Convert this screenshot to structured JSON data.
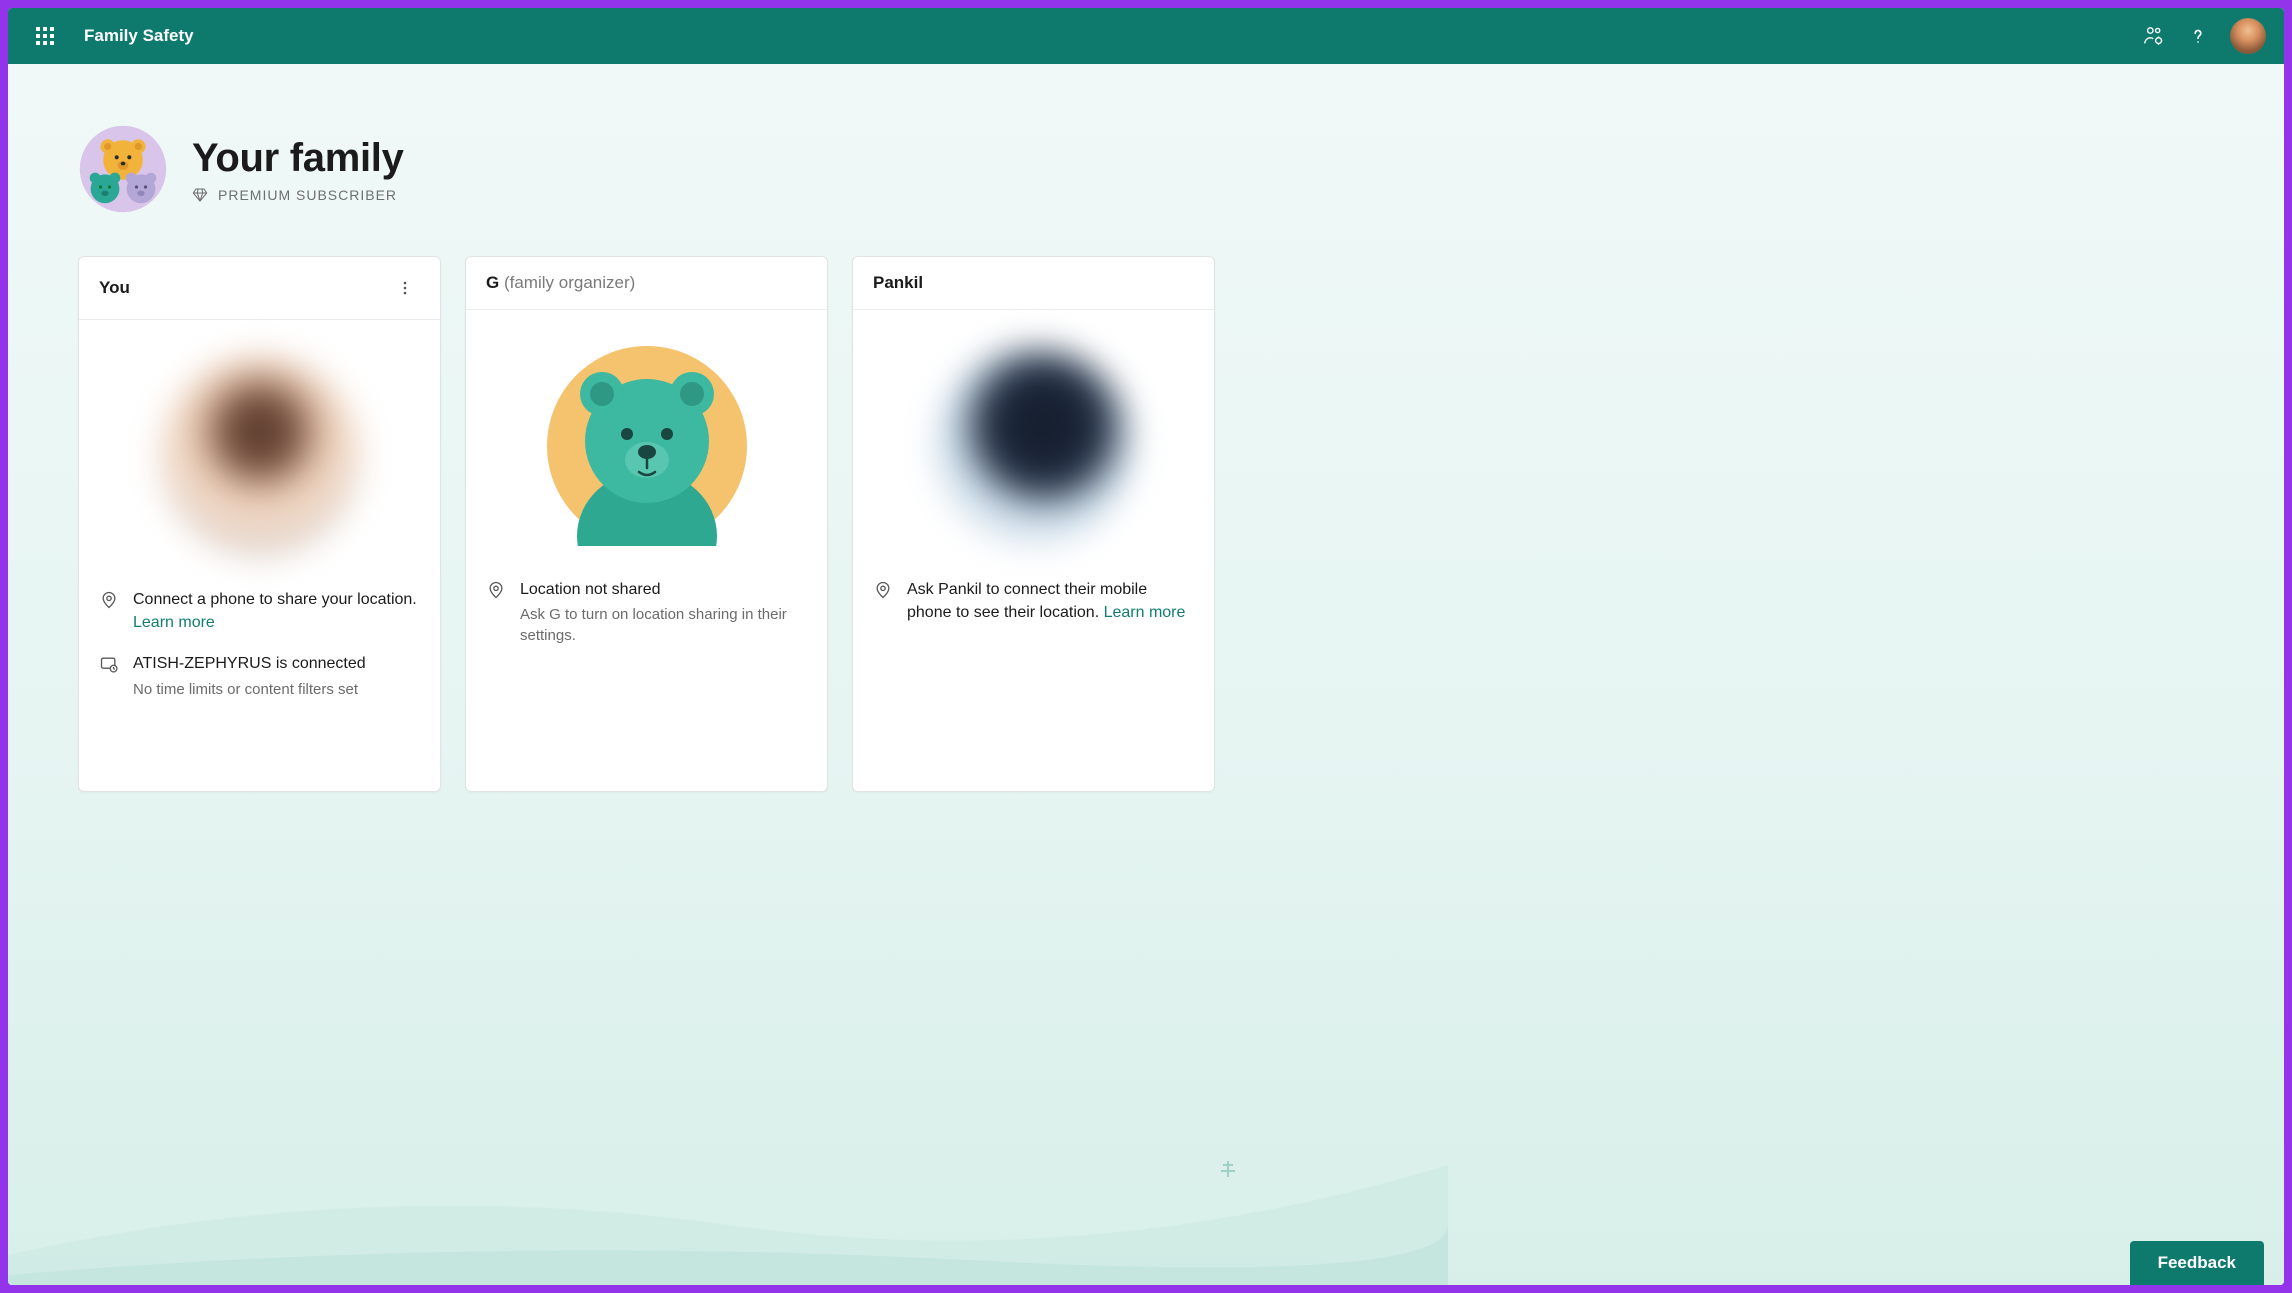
{
  "header": {
    "app_title": "Family Safety"
  },
  "page": {
    "title": "Your family",
    "premium_label": "PREMIUM SUBSCRIBER"
  },
  "members": [
    {
      "name": "You",
      "role": "",
      "has_more_menu": true,
      "avatar_style": "blur-photo-1",
      "items": [
        {
          "icon": "location",
          "text_before_link": "Connect a phone to share your location. ",
          "link": "Learn more",
          "subtext": ""
        },
        {
          "icon": "device",
          "text_before_link": "ATISH-ZEPHYRUS is connected",
          "link": "",
          "subtext": "No time limits or content filters set"
        }
      ]
    },
    {
      "name": "G",
      "role": "(family organizer)",
      "has_more_menu": false,
      "avatar_style": "bear",
      "items": [
        {
          "icon": "location",
          "text_before_link": "Location not shared",
          "link": "",
          "subtext": "Ask G to turn on location sharing in their settings."
        }
      ]
    },
    {
      "name": "Pankil",
      "role": "",
      "has_more_menu": false,
      "avatar_style": "blur-photo-2",
      "items": [
        {
          "icon": "location",
          "text_before_link": "Ask Pankil to connect their mobile phone to see their location. ",
          "link": "Learn more",
          "subtext": ""
        }
      ]
    }
  ],
  "feedback": {
    "label": "Feedback"
  }
}
